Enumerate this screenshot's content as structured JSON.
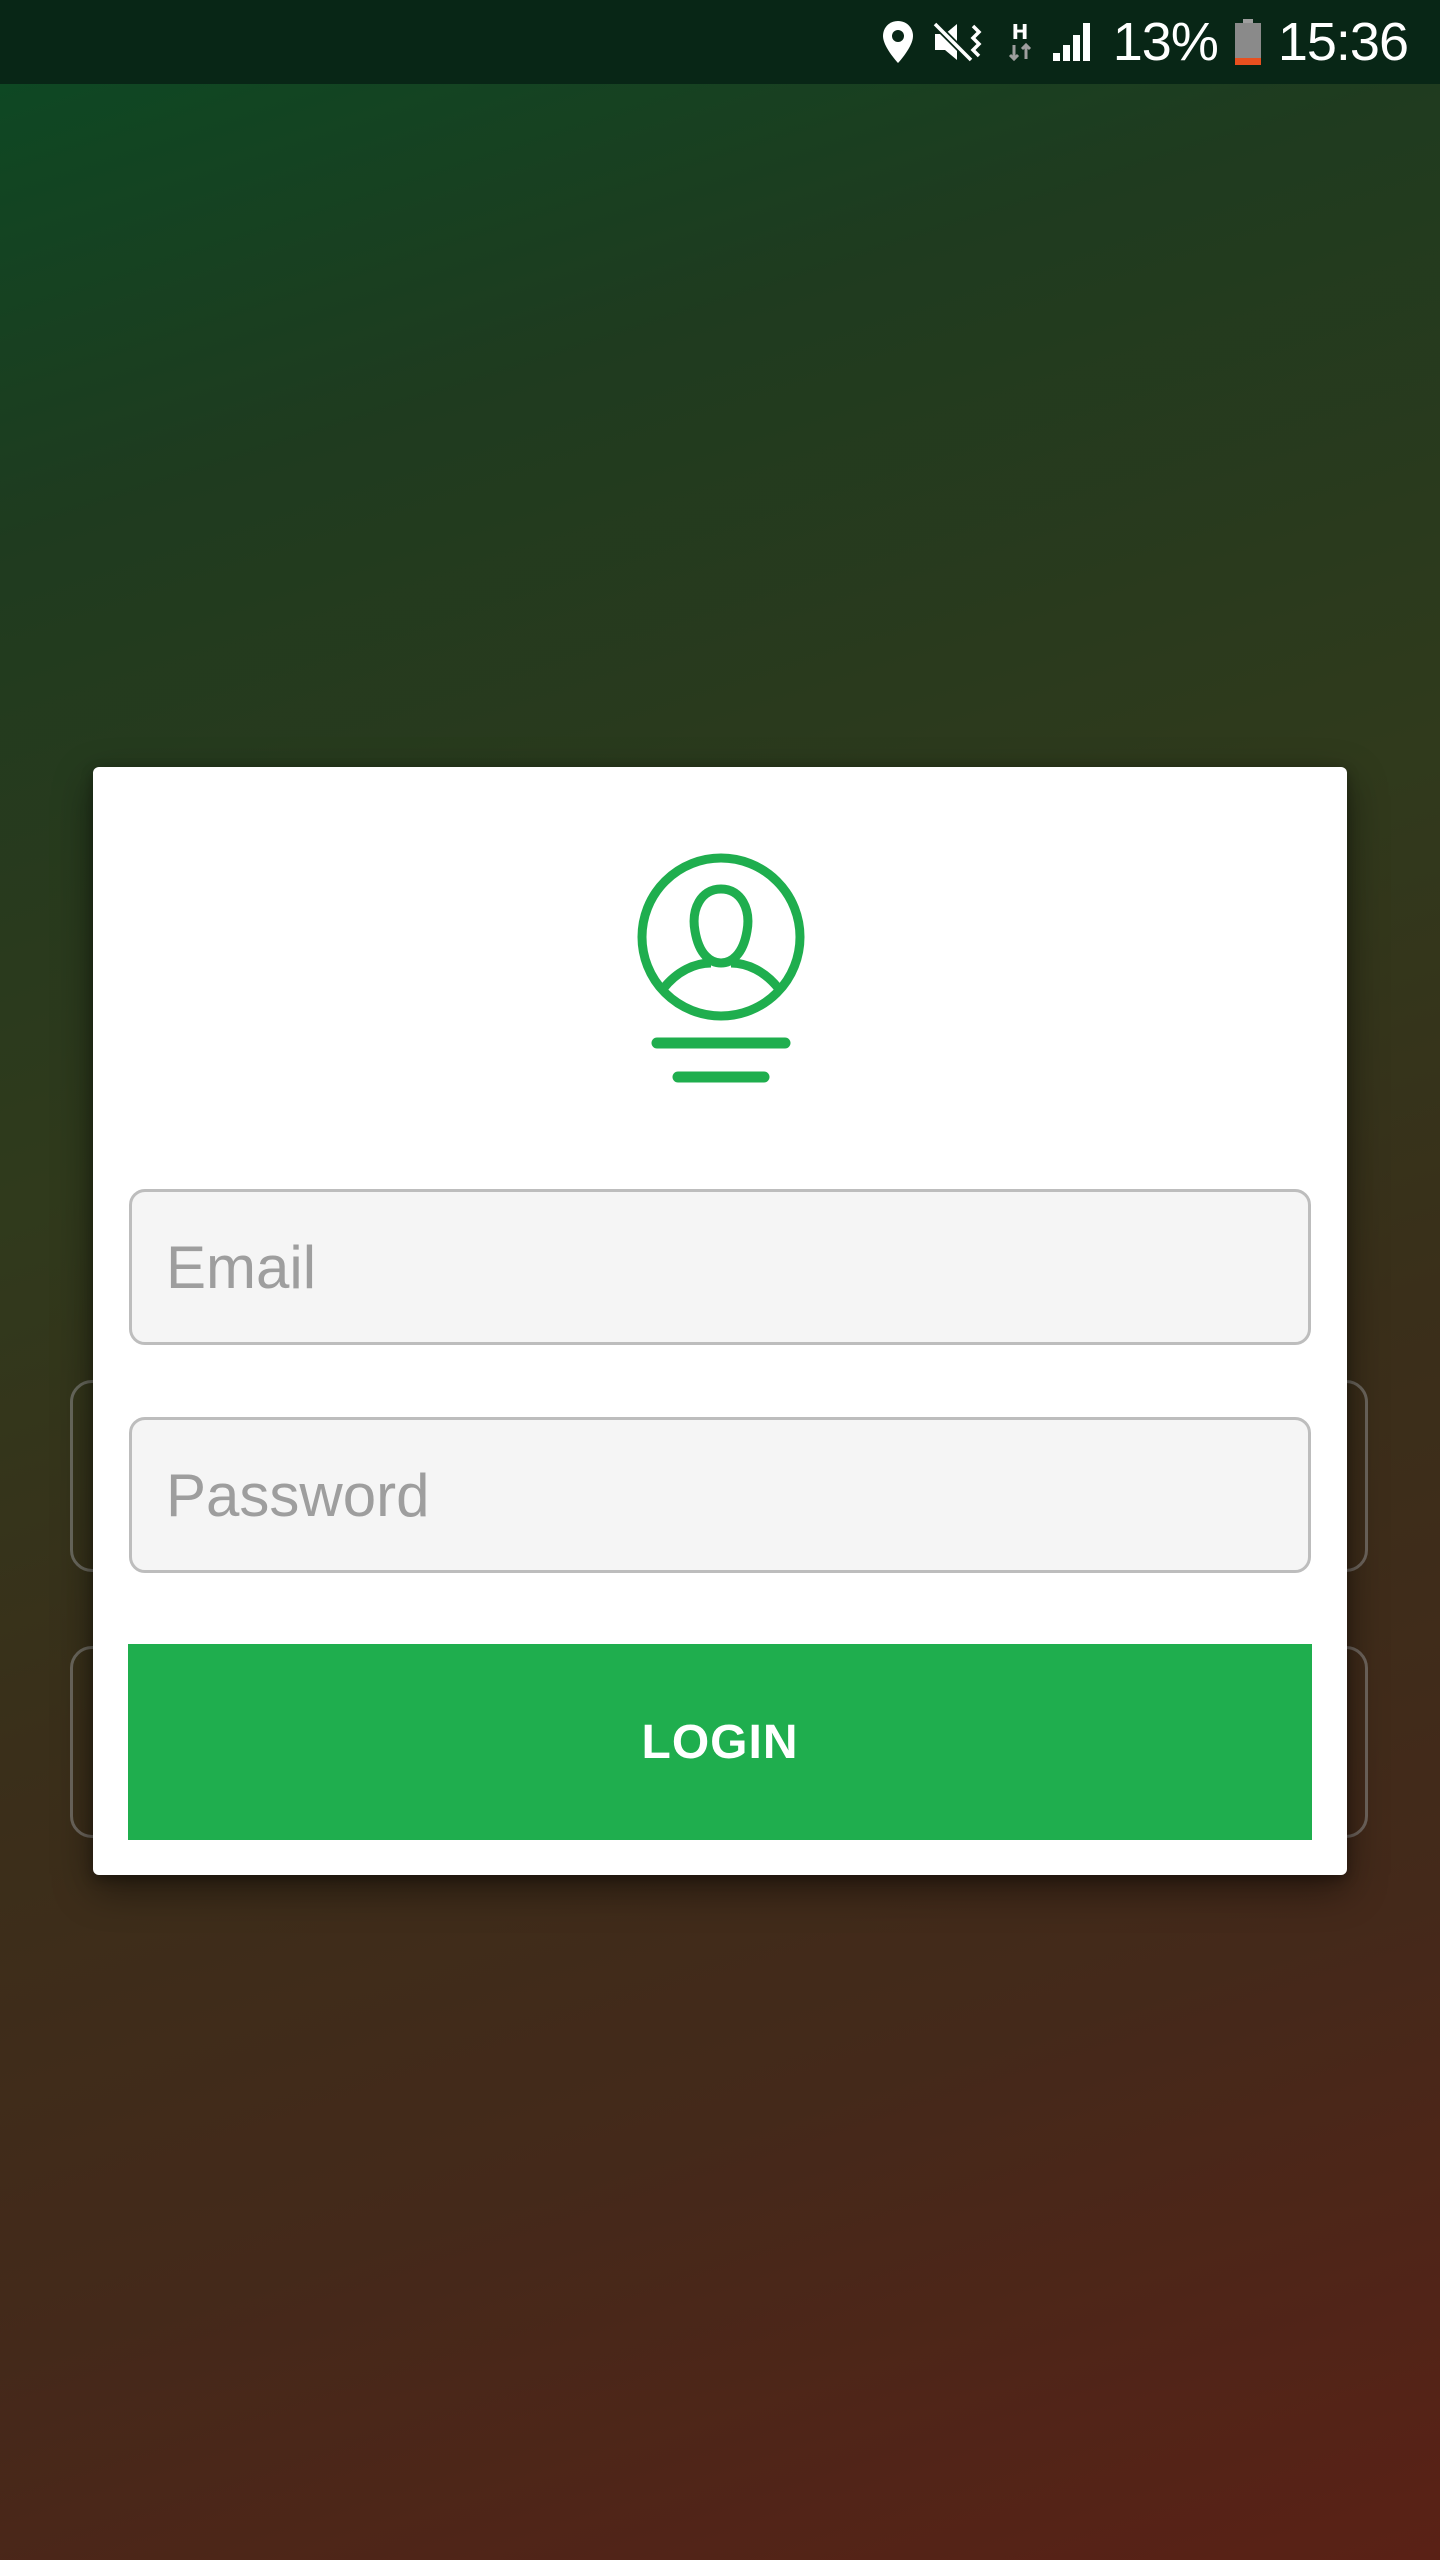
{
  "status_bar": {
    "battery_percent": "13%",
    "time": "15:36",
    "network_type": "H",
    "icons": [
      "location-icon",
      "vibrate-icon",
      "data-activity-icon",
      "signal-icon",
      "battery-icon"
    ]
  },
  "login_form": {
    "email_placeholder": "Email",
    "password_placeholder": "Password",
    "login_label": "LOGIN"
  },
  "logo": {
    "icon": "user-avatar-icon"
  },
  "colors": {
    "accent": "#1fae4e",
    "status_bar": "#082616",
    "battery_low": "#e8501f"
  }
}
